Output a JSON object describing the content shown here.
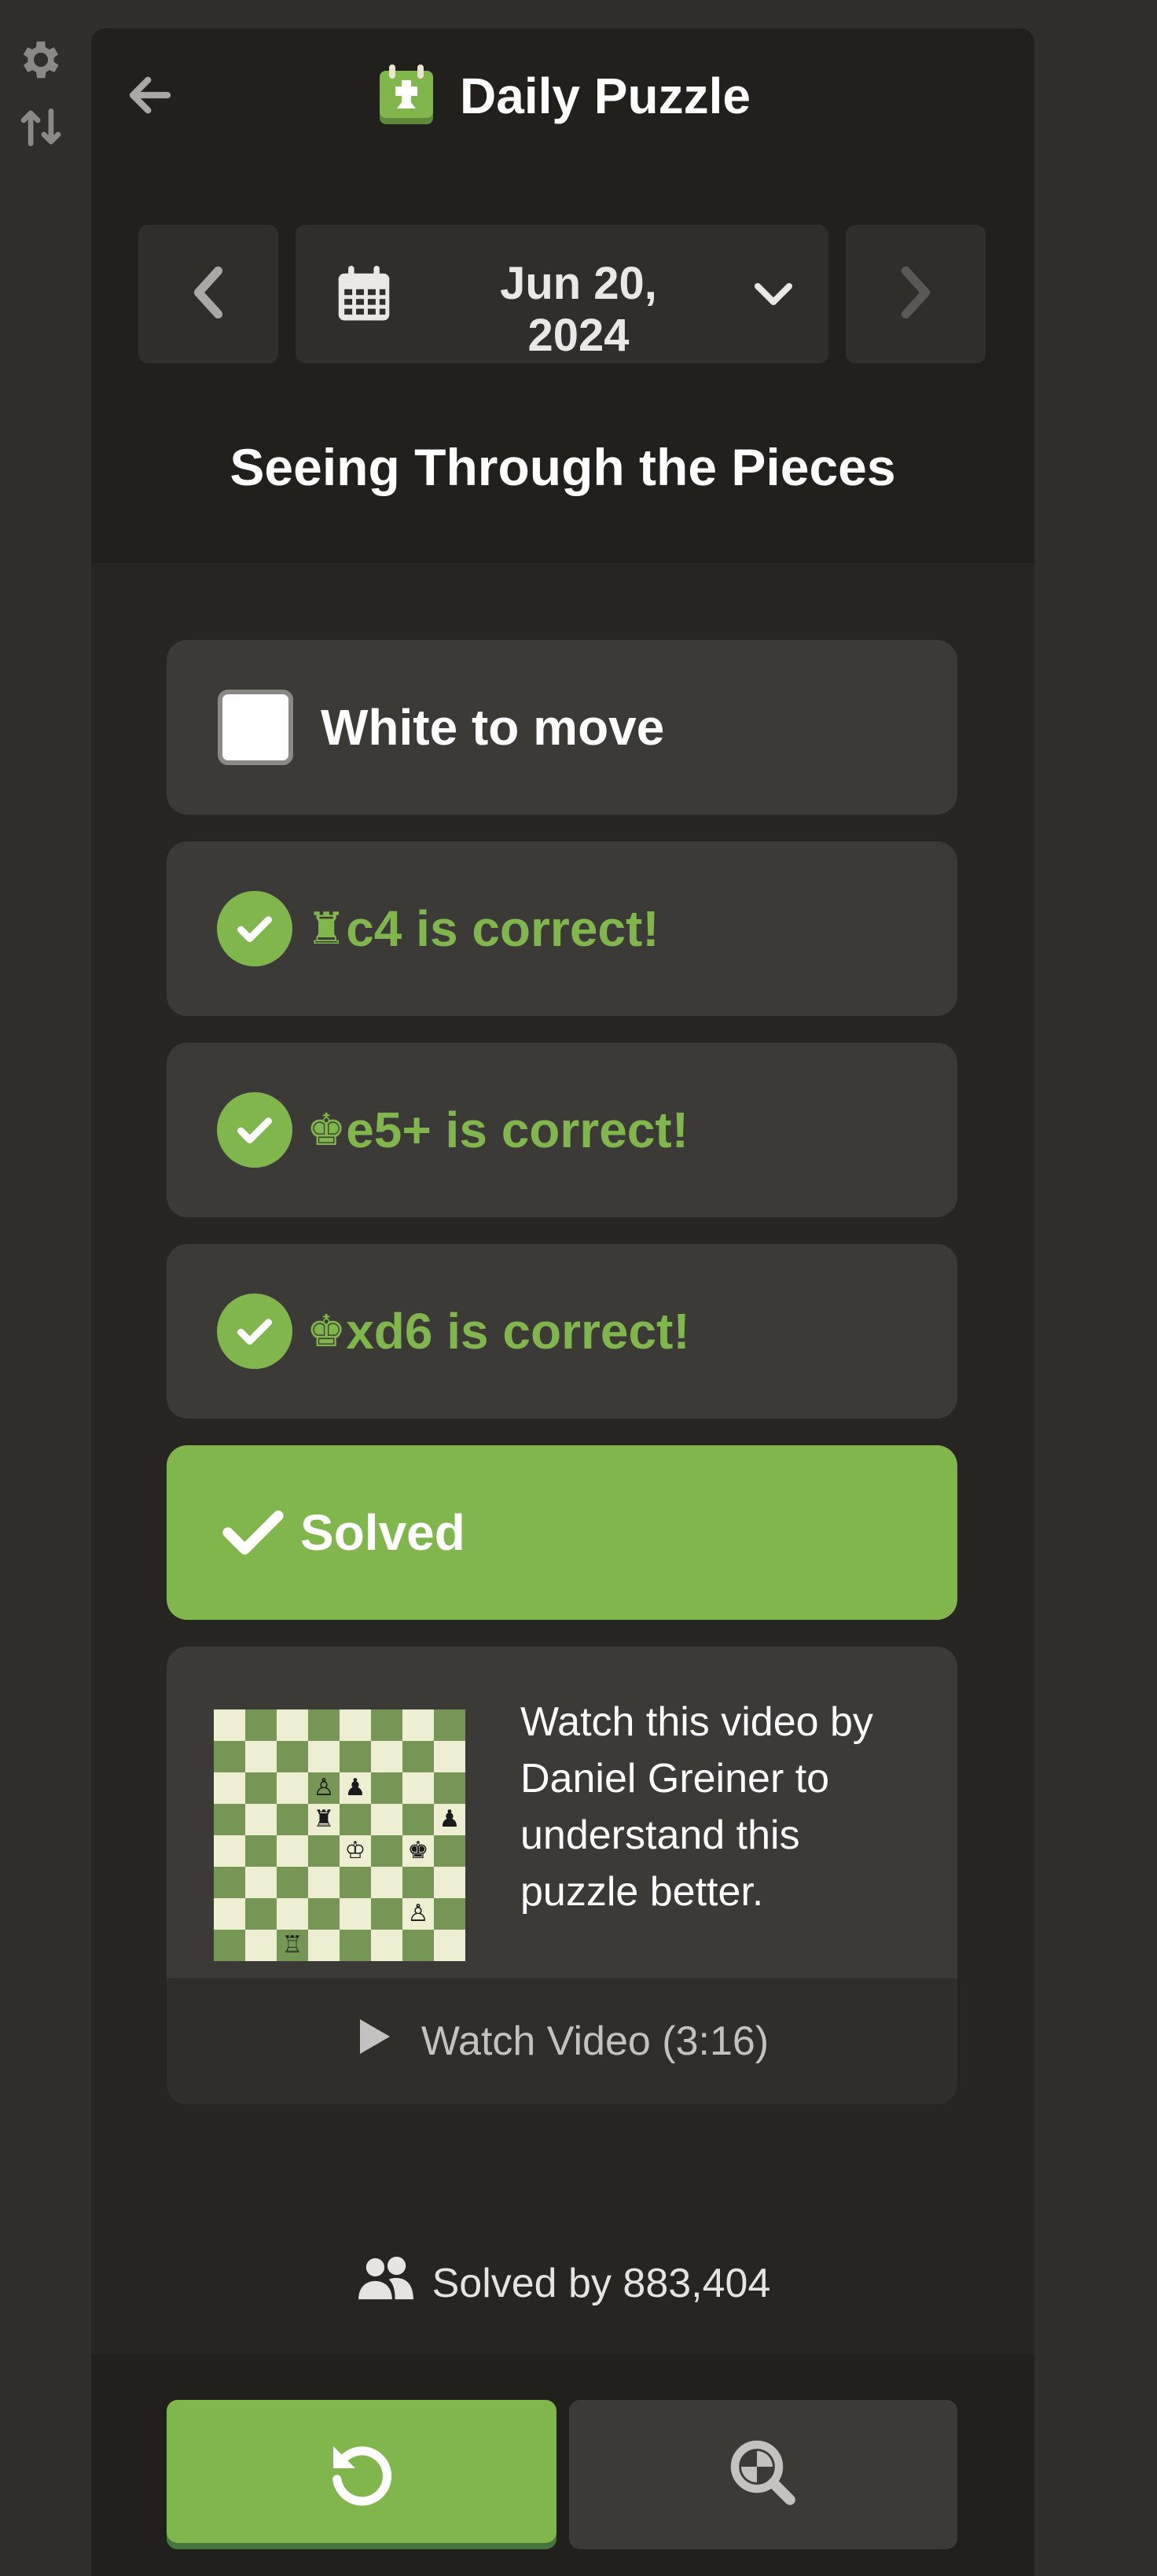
{
  "header": {
    "title": "Daily Puzzle",
    "date": "Jun 20,\n2024",
    "puzzle_title": "Seeing Through the Pieces"
  },
  "moves": {
    "to_move": "White to move",
    "steps": [
      {
        "piece": "♜",
        "text": "c4 is correct!"
      },
      {
        "piece": "♚",
        "text": "e5+ is correct!"
      },
      {
        "piece": "♚",
        "text": "xd6 is correct!"
      }
    ],
    "solved_label": "Solved"
  },
  "video": {
    "description": "Watch this video by Daniel Greiner to understand this puzzle better.",
    "watch_label": "Watch Video (3:16)"
  },
  "stats": {
    "solved_by": "Solved by 883,404"
  },
  "board": {
    "pieces": [
      {
        "row": 2,
        "col": 3,
        "glyph": "♙"
      },
      {
        "row": 2,
        "col": 4,
        "glyph": "♟"
      },
      {
        "row": 3,
        "col": 3,
        "glyph": "♜"
      },
      {
        "row": 3,
        "col": 7,
        "glyph": "♟"
      },
      {
        "row": 4,
        "col": 4,
        "glyph": "♔"
      },
      {
        "row": 4,
        "col": 6,
        "glyph": "♚"
      },
      {
        "row": 6,
        "col": 6,
        "glyph": "♙"
      },
      {
        "row": 7,
        "col": 2,
        "glyph": "♖"
      }
    ]
  },
  "colors": {
    "accent_green": "#81b64c",
    "panel": "#262522",
    "card": "#3c3a37"
  },
  "icons": [
    "gear-icon",
    "flip-board-icon",
    "back-arrow-icon",
    "daily-puzzle-icon",
    "chevron-left-icon",
    "calendar-icon",
    "chevron-down-icon",
    "chevron-right-icon",
    "check-circle-icon",
    "checkmark-icon",
    "play-icon",
    "users-icon",
    "retry-icon",
    "analysis-icon"
  ]
}
